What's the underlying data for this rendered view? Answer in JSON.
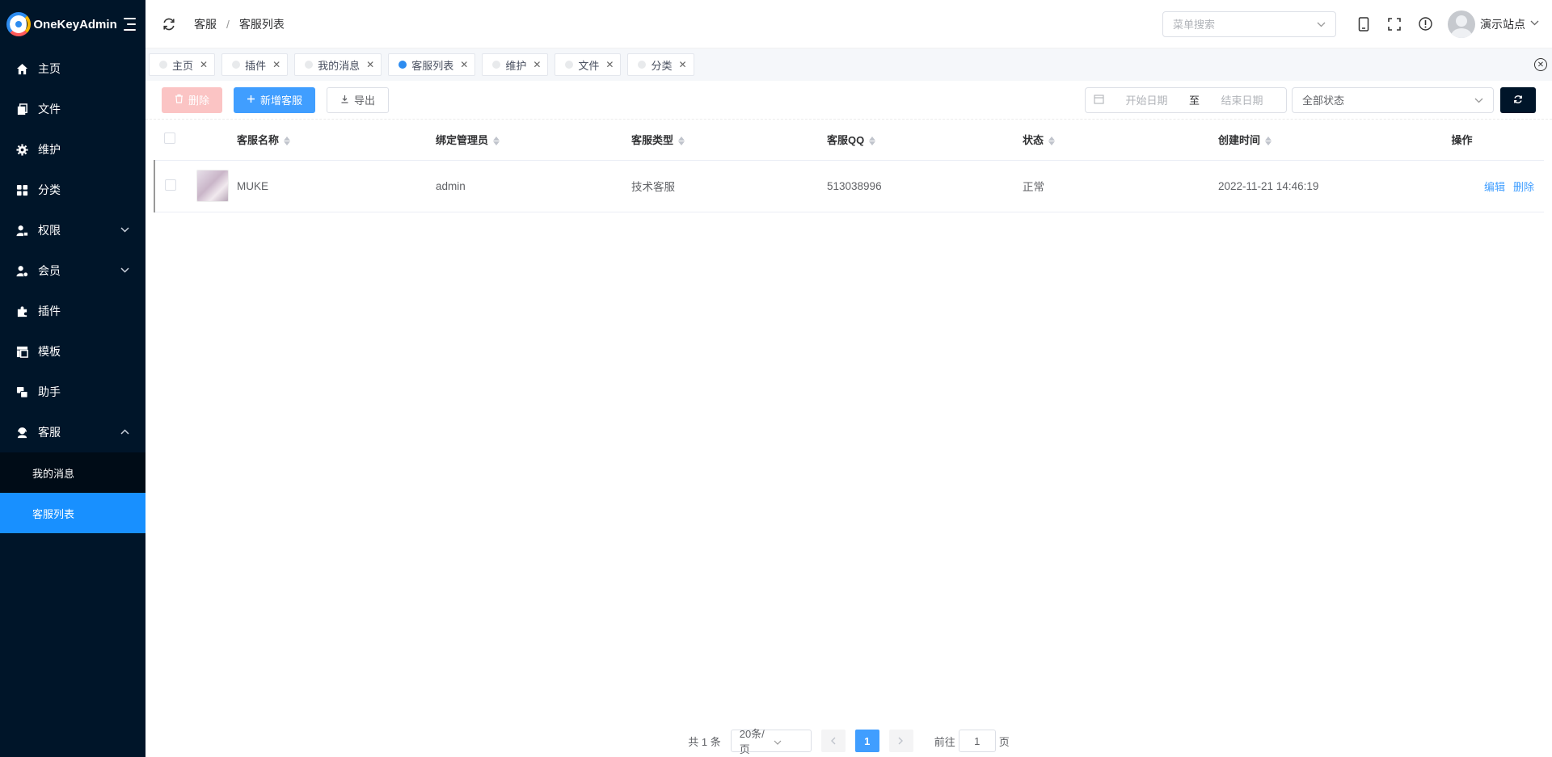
{
  "app": {
    "title": "OneKeyAdmin"
  },
  "sidebar": {
    "items": [
      {
        "label": "主页",
        "icon": "home-icon"
      },
      {
        "label": "文件",
        "icon": "file-icon"
      },
      {
        "label": "维护",
        "icon": "gear-icon"
      },
      {
        "label": "分类",
        "icon": "grid-icon"
      },
      {
        "label": "权限",
        "icon": "user-lock-icon",
        "expandable": true
      },
      {
        "label": "会员",
        "icon": "member-icon",
        "expandable": true
      },
      {
        "label": "插件",
        "icon": "puzzle-icon"
      },
      {
        "label": "模板",
        "icon": "template-icon"
      },
      {
        "label": "助手",
        "icon": "assistant-icon"
      },
      {
        "label": "客服",
        "icon": "service-icon",
        "expanded": true
      }
    ],
    "submenu": [
      {
        "label": "我的消息"
      },
      {
        "label": "客服列表",
        "active": true
      }
    ]
  },
  "header": {
    "breadcrumb": [
      "客服",
      "客服列表"
    ],
    "breadcrumb_sep": "/",
    "menu_search_placeholder": "菜单搜索",
    "user_name": "演示站点"
  },
  "tabs": [
    {
      "label": "主页"
    },
    {
      "label": "插件"
    },
    {
      "label": "我的消息"
    },
    {
      "label": "客服列表",
      "active": true
    },
    {
      "label": "维护"
    },
    {
      "label": "文件"
    },
    {
      "label": "分类"
    }
  ],
  "toolbar": {
    "delete_label": "删除",
    "add_label": "新增客服",
    "export_label": "导出",
    "start_date_placeholder": "开始日期",
    "range_sep": "至",
    "end_date_placeholder": "结束日期",
    "status_value": "全部状态"
  },
  "table": {
    "columns": [
      "客服名称",
      "绑定管理员",
      "客服类型",
      "客服QQ",
      "状态",
      "创建时间",
      "操作"
    ],
    "rows": [
      {
        "name": "MUKE",
        "admin": "admin",
        "type": "技术客服",
        "qq": "513038996",
        "status": "正常",
        "created": "2022-11-21 14:46:19",
        "edit": "编辑",
        "delete": "删除"
      }
    ]
  },
  "pagination": {
    "total": "共 1 条",
    "page_size": "20条/页",
    "current_page": "1",
    "goto_prefix": "前往",
    "goto_value": "1",
    "goto_suffix": "页"
  },
  "colors": {
    "sidebar_bg": "#001529",
    "accent": "#409eff",
    "active_menu": "#1890ff"
  }
}
